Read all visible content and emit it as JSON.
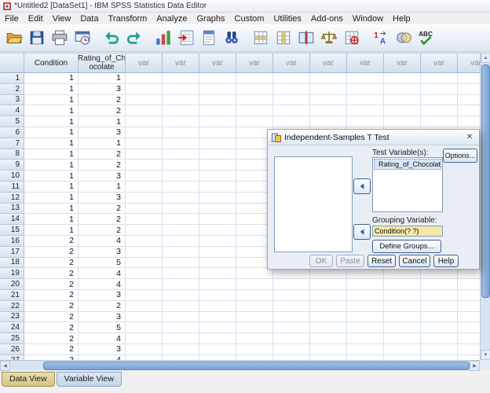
{
  "window": {
    "title": "*Untitled2 [DataSet1] - IBM SPSS Statistics Data Editor"
  },
  "menus": [
    "File",
    "Edit",
    "View",
    "Data",
    "Transform",
    "Analyze",
    "Graphs",
    "Custom",
    "Utilities",
    "Add-ons",
    "Window",
    "Help"
  ],
  "toolbar": {
    "icons": [
      "open-data",
      "save",
      "print",
      "recall-dialogs",
      "undo",
      "redo",
      "goto-chart",
      "goto-case",
      "variables",
      "find",
      "insert-cases",
      "insert-variable",
      "split-file",
      "weight-cases",
      "select-cases",
      "value-labels",
      "use-variable-sets",
      "spell-check"
    ]
  },
  "grid": {
    "columns": [
      "Condition",
      "Rating_of_Ch\nocolate"
    ],
    "var_label": "var",
    "var_count": 10,
    "rows": [
      {
        "n": "1",
        "c": "1",
        "r": "1"
      },
      {
        "n": "2",
        "c": "1",
        "r": "3"
      },
      {
        "n": "3",
        "c": "1",
        "r": "2"
      },
      {
        "n": "4",
        "c": "1",
        "r": "2"
      },
      {
        "n": "5",
        "c": "1",
        "r": "1"
      },
      {
        "n": "6",
        "c": "1",
        "r": "3"
      },
      {
        "n": "7",
        "c": "1",
        "r": "1"
      },
      {
        "n": "8",
        "c": "1",
        "r": "2"
      },
      {
        "n": "9",
        "c": "1",
        "r": "2"
      },
      {
        "n": "10",
        "c": "1",
        "r": "3"
      },
      {
        "n": "11",
        "c": "1",
        "r": "1"
      },
      {
        "n": "12",
        "c": "1",
        "r": "3"
      },
      {
        "n": "13",
        "c": "1",
        "r": "2"
      },
      {
        "n": "14",
        "c": "1",
        "r": "2"
      },
      {
        "n": "15",
        "c": "1",
        "r": "2"
      },
      {
        "n": "16",
        "c": "2",
        "r": "4"
      },
      {
        "n": "17",
        "c": "2",
        "r": "3"
      },
      {
        "n": "18",
        "c": "2",
        "r": "5"
      },
      {
        "n": "19",
        "c": "2",
        "r": "4"
      },
      {
        "n": "20",
        "c": "2",
        "r": "4"
      },
      {
        "n": "21",
        "c": "2",
        "r": "3"
      },
      {
        "n": "22",
        "c": "2",
        "r": "2"
      },
      {
        "n": "23",
        "c": "2",
        "r": "3"
      },
      {
        "n": "24",
        "c": "2",
        "r": "5"
      },
      {
        "n": "25",
        "c": "2",
        "r": "4"
      },
      {
        "n": "26",
        "c": "2",
        "r": "3"
      },
      {
        "n": "27",
        "c": "2",
        "r": "4"
      }
    ]
  },
  "dialog": {
    "title": "Independent-Samples T Test",
    "test_variables_label": "Test Variable(s):",
    "test_variables": [
      "Rating_of_Chocolate"
    ],
    "grouping_label": "Grouping Variable:",
    "grouping_value": "Condition(? ?)",
    "define_groups_label": "Define Groups...",
    "options_label": "Options...",
    "ok_label": "OK",
    "paste_label": "Paste",
    "reset_label": "Reset",
    "cancel_label": "Cancel",
    "help_label": "Help",
    "close_glyph": "✕"
  },
  "tabs": {
    "data_view": "Data View",
    "variable_view": "Variable View"
  },
  "colors": {
    "accent_blue": "#3a6ea5",
    "grid_line": "#d6e1f0",
    "header_bg": "#d2dfef",
    "scroll_thumb": "#79a2d3",
    "tab_active_bg": "#d5c585",
    "grouping_field_bg": "#f6e8a6"
  }
}
